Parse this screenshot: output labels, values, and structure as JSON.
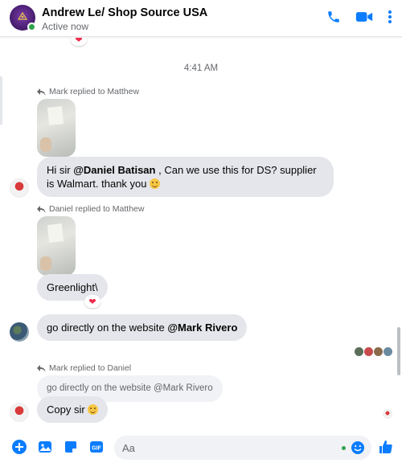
{
  "header": {
    "title": "Andrew Le/ Shop Source USA",
    "status": "Active now",
    "accent": "#0a7cff"
  },
  "chat": {
    "timestamp": "4:41 AM",
    "messages": [
      {
        "reply_note": "Mark replied to Matthew",
        "text_before": "Hi sir ",
        "mention": "@Daniel Batisan",
        "text_after": " , Can we use this for DS? supplier is Walmart. thank you"
      },
      {
        "reply_note": "Daniel replied to Matthew",
        "text": "Greenlight\\"
      },
      {
        "text_before": "go directly on the website ",
        "mention": "@Mark Rivero"
      },
      {
        "reply_note": "Mark replied to Daniel",
        "quote": "go directly on the website @Mark Rivero",
        "text": "Copy sir"
      }
    ]
  },
  "composer": {
    "placeholder": "Aa",
    "tools": [
      "plus-circle-icon",
      "photo-icon",
      "sticker-icon",
      "gif-icon"
    ],
    "gif_label": "GIF"
  },
  "icons": {
    "call": "phone-icon",
    "video": "video-camera-icon",
    "more": "dots-vertical-icon",
    "like": "thumbs-up-icon"
  }
}
